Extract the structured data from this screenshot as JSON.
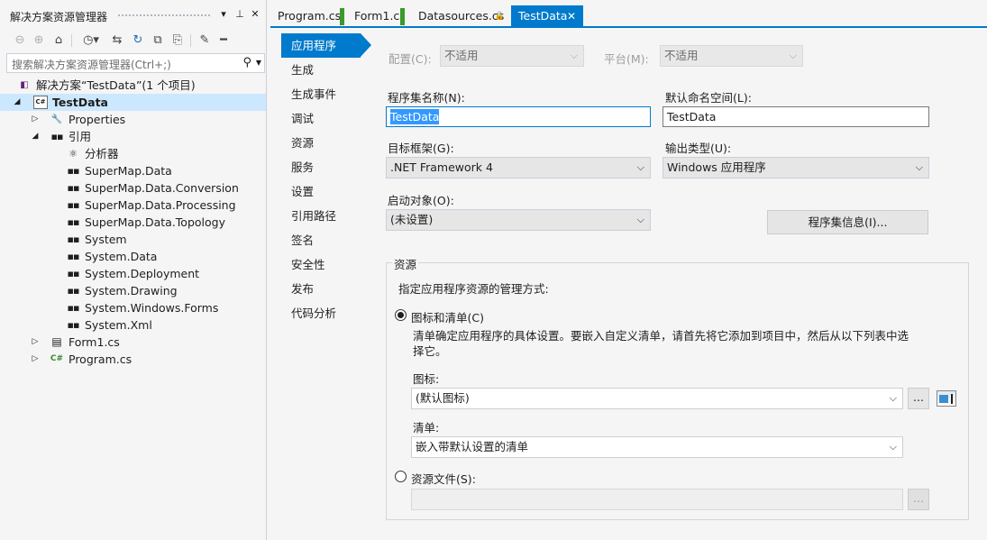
{
  "solution_explorer": {
    "title": "解决方案资源管理器",
    "search_placeholder": "搜索解决方案资源管理器(Ctrl+;)",
    "solution_label": "解决方案“TestData”(1 个项目)",
    "project_label": "TestData",
    "project_badge": "C#",
    "properties_label": "Properties",
    "references_label": "引用",
    "references": [
      "分析器",
      "SuperMap.Data",
      "SuperMap.Data.Conversion",
      "SuperMap.Data.Processing",
      "SuperMap.Data.Topology",
      "System",
      "System.Data",
      "System.Deployment",
      "System.Drawing",
      "System.Windows.Forms",
      "System.Xml"
    ],
    "form1_label": "Form1.cs",
    "program_label": "Program.cs",
    "cs_badge": "C#"
  },
  "tabs": [
    {
      "label": "Program.cs"
    },
    {
      "label": "Form1.cs"
    },
    {
      "label": "Datasources.cs"
    },
    {
      "label": "TestData"
    }
  ],
  "nav": {
    "items": [
      "应用程序",
      "生成",
      "生成事件",
      "调试",
      "资源",
      "服务",
      "设置",
      "引用路径",
      "签名",
      "安全性",
      "发布",
      "代码分析"
    ]
  },
  "app": {
    "config_label": "配置(C):",
    "config_value": "不适用",
    "platform_label": "平台(M):",
    "platform_value": "不适用",
    "assembly_name_label": "程序集名称(N):",
    "assembly_name_value": "TestData",
    "default_ns_label": "默认命名空间(L):",
    "default_ns_value": "TestData",
    "target_fw_label": "目标框架(G):",
    "target_fw_value": ".NET Framework 4",
    "output_type_label": "输出类型(U):",
    "output_type_value": "Windows 应用程序",
    "startup_label": "启动对象(O):",
    "startup_value": "(未设置)",
    "assembly_info_button": "程序集信息(I)...",
    "resources_group": "资源",
    "resources_desc": "指定应用程序资源的管理方式:",
    "icon_manifest_radio": "图标和清单(C)",
    "icon_manifest_desc": "清单确定应用程序的具体设置。要嵌入自定义清单，请首先将它添加到项目中，然后从以下列表中选择它。",
    "icon_label": "图标:",
    "icon_value": "(默认图标)",
    "browse_button": "...",
    "manifest_label": "清单:",
    "manifest_value": "嵌入带默认设置的清单",
    "resource_file_radio": "资源文件(S):",
    "resource_file_value": "",
    "resource_browse_button": "..."
  }
}
